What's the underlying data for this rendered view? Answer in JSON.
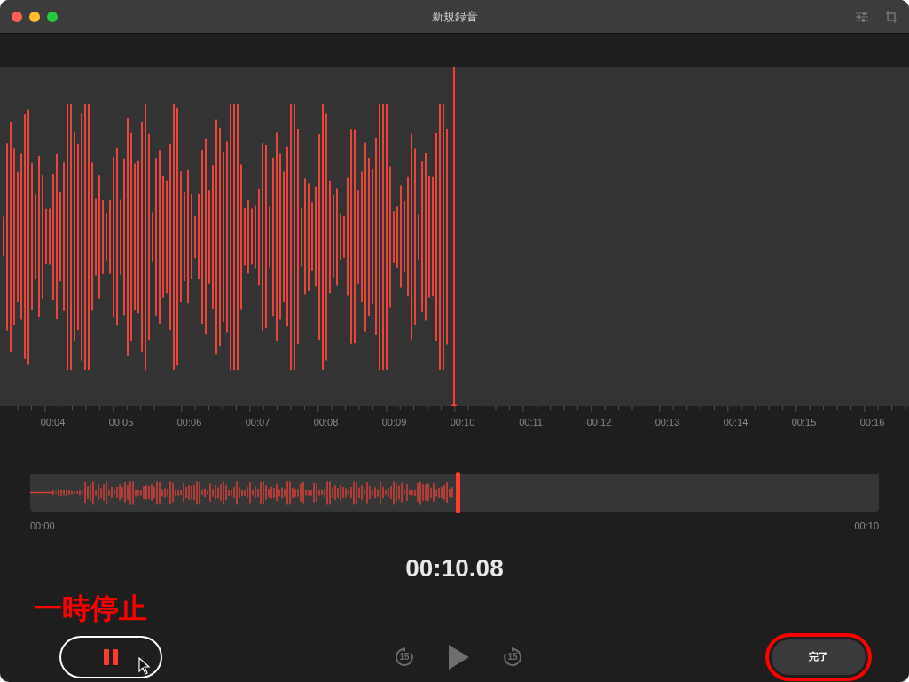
{
  "window": {
    "title": "新規録音"
  },
  "timeline": {
    "labels": [
      "00:04",
      "00:05",
      "00:06",
      "00:07",
      "00:08",
      "00:09",
      "00:10",
      "00:11",
      "00:12",
      "00:13",
      "00:14",
      "00:15",
      "00:16"
    ]
  },
  "overview": {
    "start": "00:00",
    "end": "00:10",
    "level": 0.504
  },
  "elapsed": "00:10.08",
  "annotation": {
    "label": "一時停止"
  },
  "controls": [
    {
      "kind": "pause",
      "color": "#ffffff"
    },
    {
      "kind": "skip_back",
      "text": "15"
    },
    {
      "kind": "play"
    },
    {
      "kind": "skip_forward",
      "text": "15"
    },
    {
      "kind": "done",
      "text": "完了",
      "color": "#ff0000"
    }
  ]
}
